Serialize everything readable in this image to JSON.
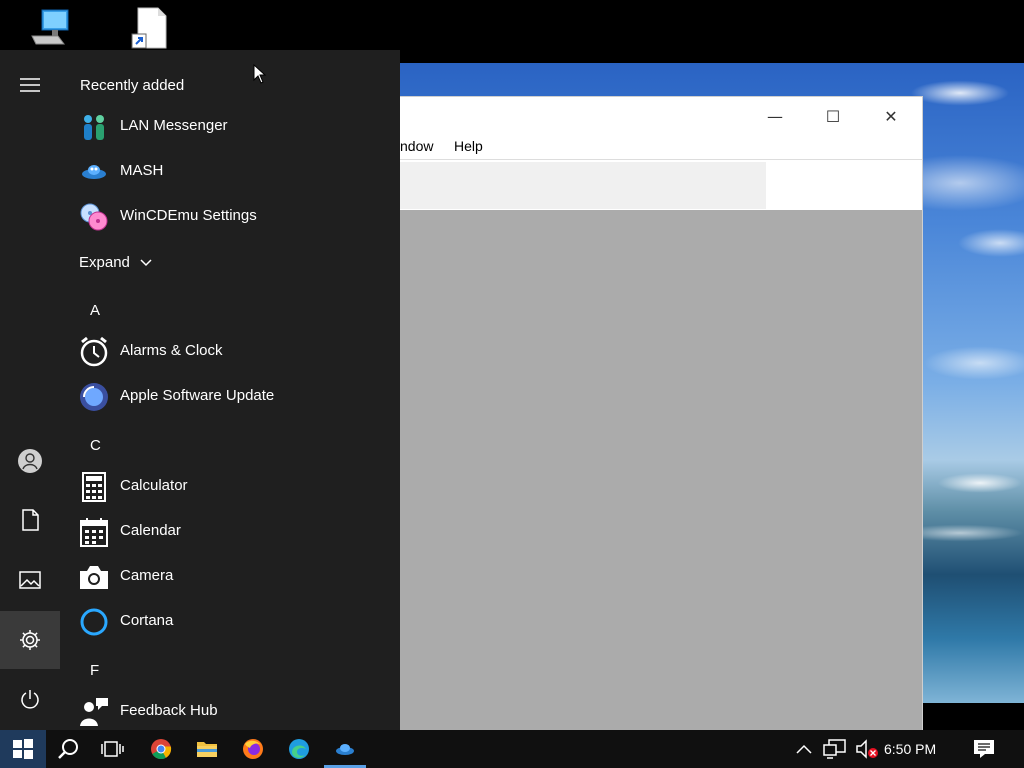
{
  "desktop": {
    "icons": [
      {
        "name": "this-pc-icon"
      },
      {
        "name": "file-shortcut-icon"
      }
    ]
  },
  "app_window": {
    "menu": [
      "ndow",
      "Help"
    ],
    "controls": {
      "minimize": "—",
      "maximize": "☐",
      "close": "✕"
    }
  },
  "start_menu": {
    "recently_added_title": "Recently added",
    "recent": [
      {
        "label": "LAN Messenger",
        "icon": "lan-messenger-icon"
      },
      {
        "label": "MASH",
        "icon": "mash-icon"
      },
      {
        "label": "WinCDEmu Settings",
        "icon": "wincdemu-icon"
      }
    ],
    "expand_label": "Expand",
    "groups": [
      {
        "letter": "A",
        "items": [
          {
            "label": "Alarms & Clock",
            "icon": "alarm-clock-icon"
          },
          {
            "label": "Apple Software Update",
            "icon": "apple-update-icon"
          }
        ]
      },
      {
        "letter": "C",
        "items": [
          {
            "label": "Calculator",
            "icon": "calculator-icon"
          },
          {
            "label": "Calendar",
            "icon": "calendar-icon"
          },
          {
            "label": "Camera",
            "icon": "camera-icon"
          },
          {
            "label": "Cortana",
            "icon": "cortana-icon"
          }
        ]
      },
      {
        "letter": "F",
        "items": [
          {
            "label": "Feedback Hub",
            "icon": "feedback-hub-icon"
          }
        ]
      }
    ],
    "rail": [
      "hamburger-menu-icon",
      "user-account-icon",
      "documents-icon",
      "pictures-icon",
      "settings-gear-icon",
      "power-icon"
    ]
  },
  "taskbar": {
    "time": "6:50 PM",
    "pinned": [
      "start-windows-icon",
      "search-icon",
      "task-view-icon",
      "chrome-icon",
      "file-explorer-icon",
      "firefox-icon",
      "edge-icon",
      "mash-taskbar-icon"
    ],
    "tray": [
      "show-hidden-icons-chevron-icon",
      "network-icon",
      "volume-muted-icon",
      "notifications-icon"
    ]
  }
}
